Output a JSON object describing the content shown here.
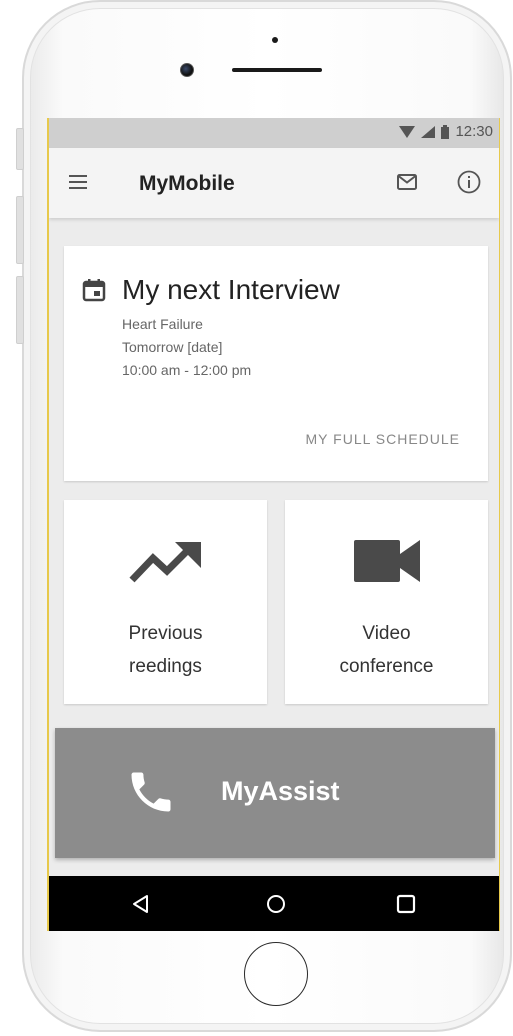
{
  "status_bar": {
    "time": "12:30",
    "icons": [
      "wifi-icon",
      "signal-icon",
      "battery-icon"
    ]
  },
  "app_bar": {
    "title": "MyMobile",
    "icons": [
      "menu-icon",
      "mail-icon",
      "info-icon"
    ]
  },
  "interview_card": {
    "title": "My next Interview",
    "topic": "Heart Failure",
    "date": "Tomorrow [date]",
    "time": "10:00 am - 12:00 pm",
    "link_label": "MY FULL SCHEDULE"
  },
  "tiles": [
    {
      "line1": "Previous",
      "line2": "reedings",
      "icon": "trending-up-icon"
    },
    {
      "line1": "Video",
      "line2": "conference",
      "icon": "videocam-icon"
    }
  ],
  "assist": {
    "label": "MyAssist",
    "icon": "phone-icon"
  },
  "nav_bar": {
    "buttons": [
      "back-icon",
      "home-icon",
      "recents-icon"
    ]
  },
  "colors": {
    "status_bar": "#cfcfcf",
    "app_bar": "#f4f4f4",
    "screen_bg": "#ececec",
    "assist_bg": "#8c8c8c",
    "icon_dark": "#555555",
    "screen_edge": "#e7c94c"
  }
}
